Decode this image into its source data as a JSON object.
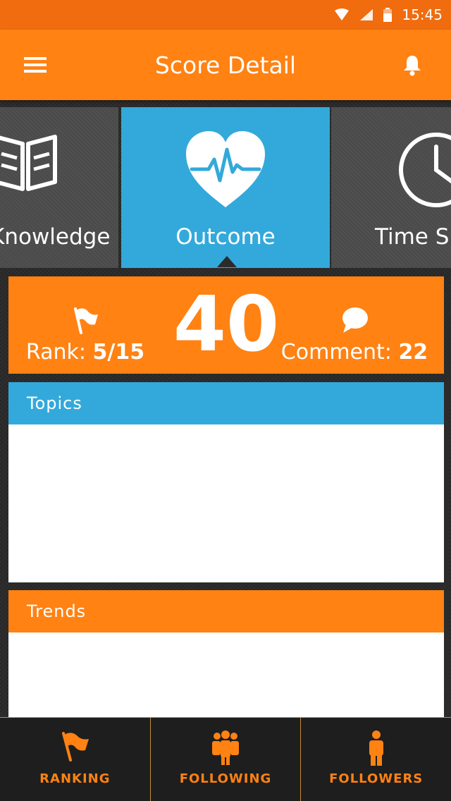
{
  "status_bar": {
    "time": "15:45"
  },
  "app_bar": {
    "title": "Score Detail"
  },
  "tiles": [
    {
      "label": "Knowledge",
      "icon": "book-icon"
    },
    {
      "label": "Outcome",
      "icon": "heart-pulse-icon"
    },
    {
      "label": "Time Spent",
      "icon": "clock-icon"
    }
  ],
  "score": {
    "value": "40",
    "rank_label": "Rank:",
    "rank_value": "5/15",
    "comment_label": "Comment:",
    "comment_value": "22"
  },
  "panels": {
    "topics_title": "Topics",
    "trends_title": "Trends"
  },
  "bottom_nav": [
    {
      "label": "RANKING",
      "icon": "flag-icon"
    },
    {
      "label": "FOLLOWING",
      "icon": "group-icon"
    },
    {
      "label": "FOLLOWERS",
      "icon": "person-icon"
    }
  ],
  "colors": {
    "orange": "#ff8213",
    "status_orange": "#f06c0e",
    "blue": "#33a9db",
    "tile_gray": "#4a4a4a"
  }
}
